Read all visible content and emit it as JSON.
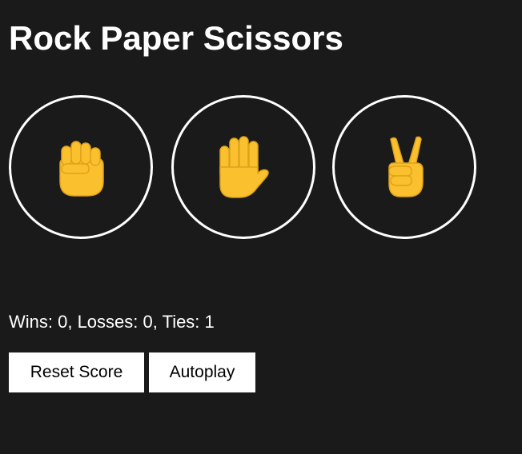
{
  "title": "Rock Paper Scissors",
  "moves": [
    {
      "name": "rock",
      "icon": "raised-fist-icon"
    },
    {
      "name": "paper",
      "icon": "raised-hand-icon"
    },
    {
      "name": "scissors",
      "icon": "victory-hand-icon"
    }
  ],
  "score_text": "Wins: 0, Losses: 0, Ties: 1",
  "buttons": {
    "reset_label": "Reset Score",
    "autoplay_label": "Autoplay"
  },
  "colors": {
    "background": "#1a1a1a",
    "text": "#ffffff",
    "emoji": "#fbc02d",
    "button_bg": "#ffffff"
  }
}
